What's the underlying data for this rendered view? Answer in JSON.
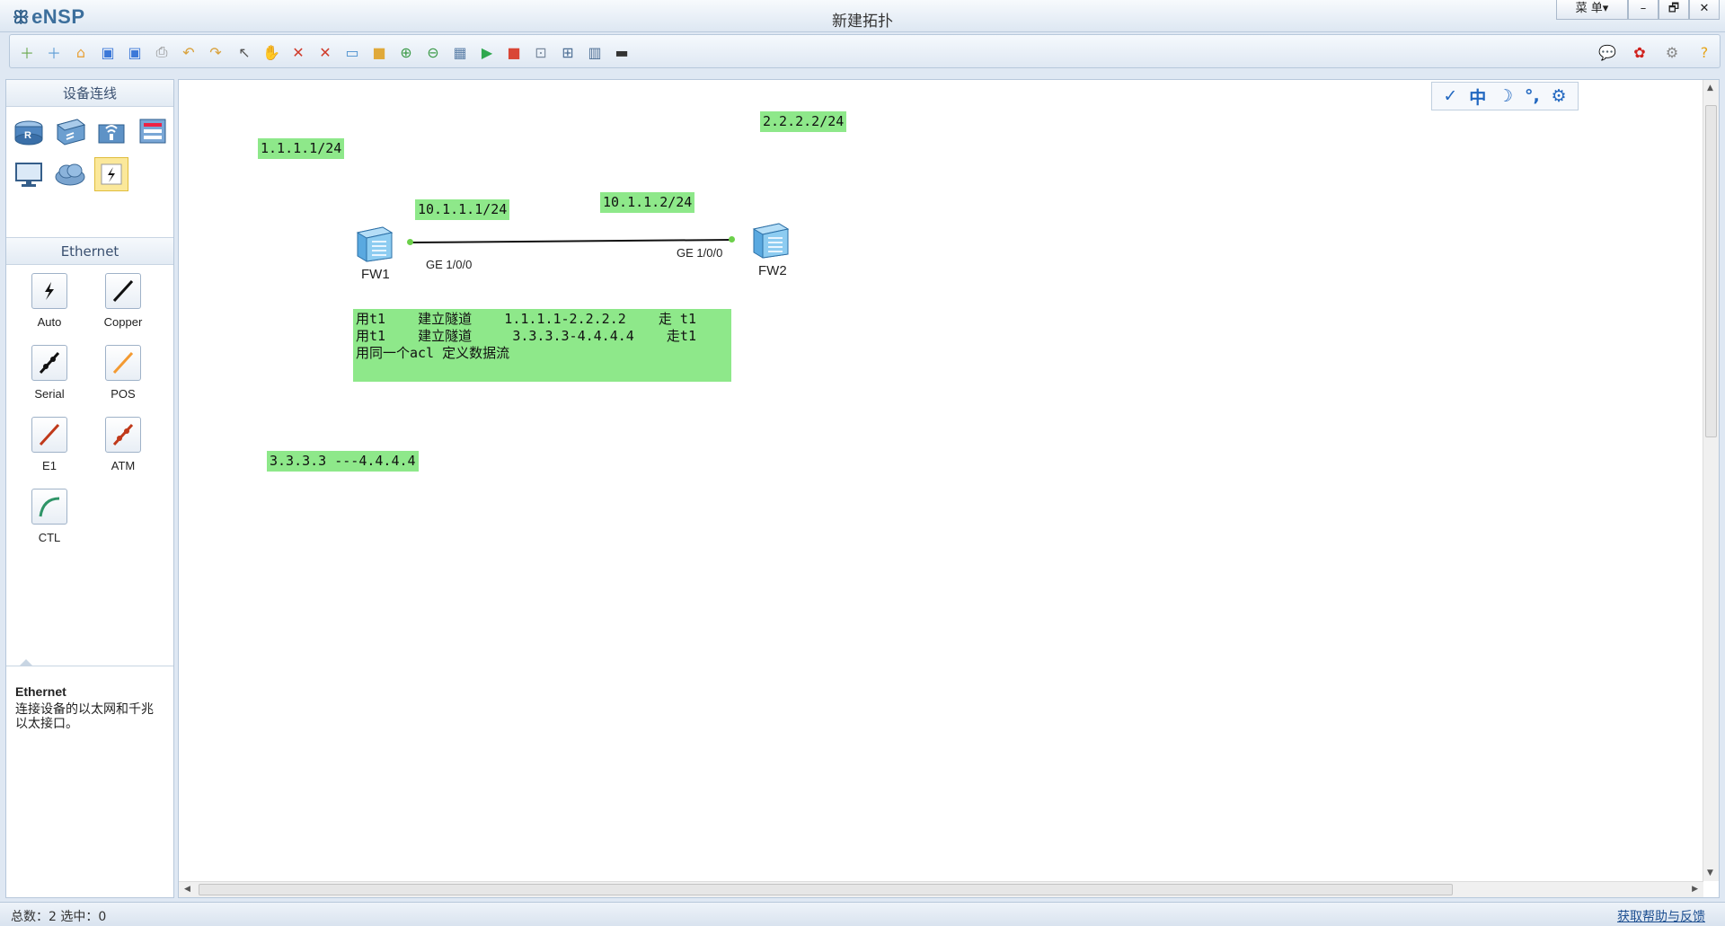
{
  "app": {
    "logo": "eNSP",
    "title": "新建拓扑"
  },
  "window_buttons": {
    "menu": "菜 单▾",
    "minimize": "–",
    "restore": "🗗",
    "close": "✕"
  },
  "toolbar": {
    "icons": [
      "new-topology-icon",
      "new-lab-icon",
      "open-icon",
      "save-icon",
      "save-as-icon",
      "print-icon",
      "undo-icon",
      "redo-icon",
      "select-icon",
      "pan-icon",
      "delete-icon",
      "delete-link-icon",
      "text-icon",
      "rectangle-icon",
      "zoom-in-icon",
      "zoom-out-icon",
      "fit-icon",
      "start-icon",
      "stop-icon",
      "capture-icon",
      "topology-icon",
      "table-icon",
      "console-icon"
    ],
    "right_icons": [
      "chat-icon",
      "huawei-icon",
      "settings-icon",
      "help-icon"
    ]
  },
  "left_panel": {
    "devices_header": "设备连线",
    "section_header": "Ethernet",
    "cables": [
      {
        "label": "Auto"
      },
      {
        "label": "Copper"
      },
      {
        "label": "Serial"
      },
      {
        "label": "POS"
      },
      {
        "label": "E1"
      },
      {
        "label": "ATM"
      },
      {
        "label": "CTL"
      }
    ],
    "description_title": "Ethernet",
    "description_text": "连接设备的以太网和千兆以太接口。"
  },
  "canvas": {
    "notes": {
      "ip1": "1.1.1.1/24",
      "ip2": "2.2.2.2/24",
      "link_left": "10.1.1.1/24",
      "link_right": "10.1.1.2/24",
      "tunnel_text": "用t1    建立隧道    1.1.1.1-2.2.2.2    走 t1\n用t1    建立隧道     3.3.3.3-4.4.4.4    走t1\n用同一个acl 定义数据流",
      "range": "3.3.3.3 ---4.4.4.4"
    },
    "devices": {
      "fw1": "FW1",
      "fw2": "FW2"
    },
    "ports": {
      "fw1_port": "GE 1/0/0",
      "fw2_port": "GE 1/0/0"
    },
    "float_tools": [
      "✓",
      "中",
      "☽",
      "°,",
      "⚙"
    ]
  },
  "statusbar": {
    "summary": "总数：2 选中：0",
    "help": "获取帮助与反馈"
  },
  "colors": {
    "note_bg": "#8ee88a",
    "link_dot": "#6cd04a",
    "accent": "#2167c0"
  }
}
